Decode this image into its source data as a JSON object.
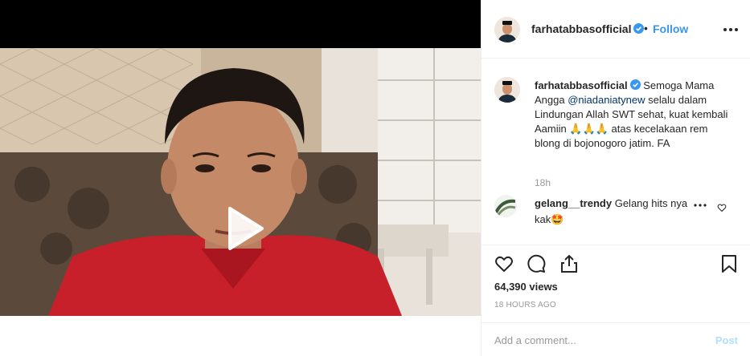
{
  "post": {
    "username": "farhatabbasofficial",
    "follow_label": "Follow",
    "dot": "•",
    "verified": true,
    "more_icon": "more-horizontal-icon"
  },
  "caption": {
    "username": "farhatabbasofficial",
    "text_before_mention": "Semoga Mama Angga ",
    "mention": "@niadaniatynew",
    "text_after_mention": " selalu dalam Lindungan Allah SWT sehat, kuat kembali Aamiin 🙏🙏🙏 atas kecelakaan rem blong di bojonogoro jatim. FA",
    "time": "18h"
  },
  "comments": [
    {
      "username": "gelang__trendy",
      "text": "Gelang hits nya kak🤩"
    }
  ],
  "stats": {
    "views": "64,390 views",
    "posted": "18 HOURS AGO"
  },
  "add_comment": {
    "placeholder": "Add a comment...",
    "post_label": "Post"
  },
  "colors": {
    "link_blue": "#3897f0",
    "mention_blue": "#003569",
    "post_disabled": "#b2dffc",
    "muted": "#999999"
  },
  "icons": [
    "play-icon",
    "heart-icon",
    "comment-icon",
    "share-icon",
    "bookmark-icon",
    "verified-badge-icon"
  ]
}
